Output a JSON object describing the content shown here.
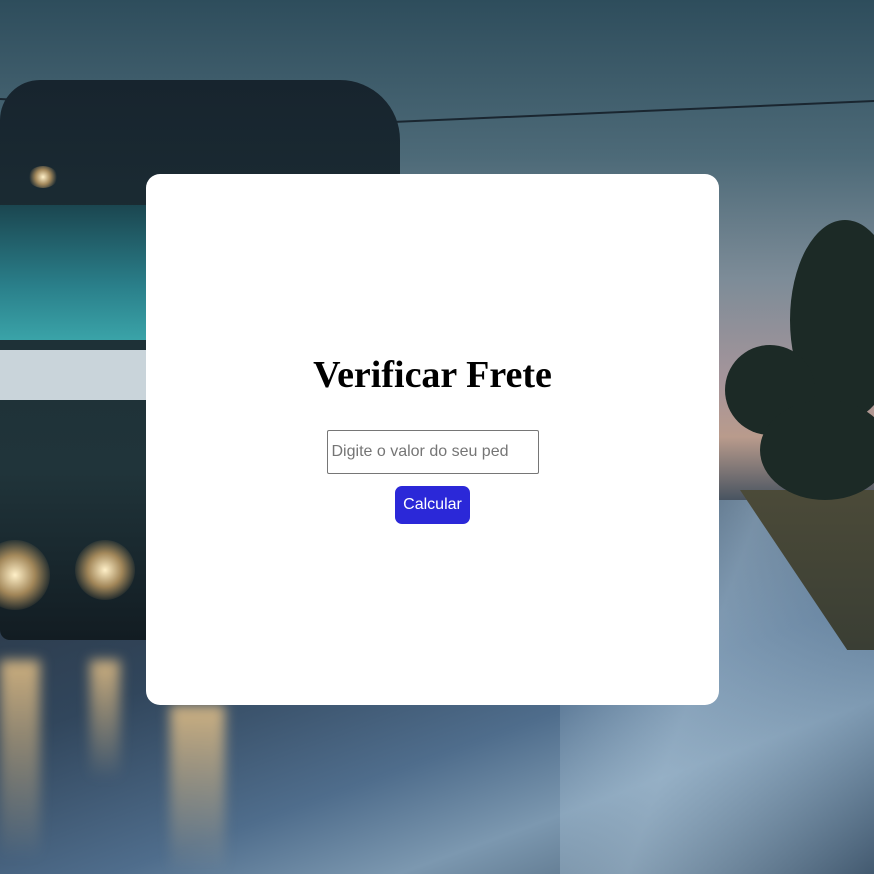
{
  "card": {
    "title": "Verificar Frete",
    "input": {
      "placeholder": "Digite o valor do seu ped",
      "value": ""
    },
    "button_label": "Calcular"
  },
  "background": {
    "image": "truck-on-wet-road-at-dusk"
  },
  "colors": {
    "button": "#2b28d8",
    "card": "#ffffff",
    "title": "#000000"
  }
}
